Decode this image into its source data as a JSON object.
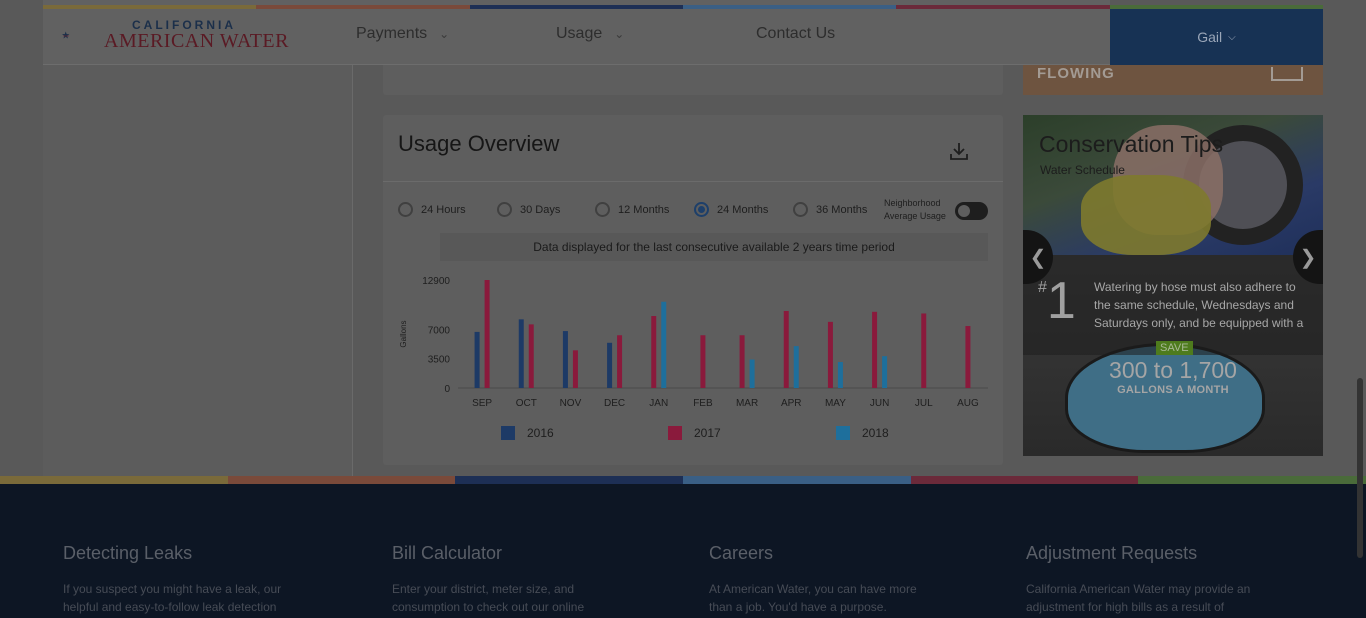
{
  "brand": {
    "name_top": "CALIFORNIA",
    "name_bottom": "AMERICAN WATER",
    "stripe_colors": [
      "#7a6a3a",
      "#7a4a3a",
      "#1d2f55",
      "#3a5f85",
      "#6b2a3a",
      "#4a6b3a"
    ]
  },
  "nav": {
    "payments": "Payments",
    "usage": "Usage",
    "contact": "Contact Us",
    "user": "Gail"
  },
  "promo_top": {
    "label": "FLOWING"
  },
  "usage": {
    "title": "Usage Overview",
    "periods": [
      {
        "label": "24 Hours",
        "checked": false
      },
      {
        "label": "30 Days",
        "checked": false
      },
      {
        "label": "12 Months",
        "checked": false
      },
      {
        "label": "24 Months",
        "checked": true
      },
      {
        "label": "36 Months",
        "checked": false
      }
    ],
    "neighborhood_line1": "Neighborhood",
    "neighborhood_line2": "Average Usage",
    "neighborhood_on": false,
    "notice": "Data displayed for the last consecutive available 2 years time period"
  },
  "chart_data": {
    "type": "bar",
    "ylabel": "Gallons",
    "ylim": [
      0,
      12900
    ],
    "yticks": [
      "12900",
      "7000",
      "3500",
      "0"
    ],
    "ytick_values": [
      12900,
      7000,
      3500,
      0
    ],
    "categories": [
      "SEP",
      "OCT",
      "NOV",
      "DEC",
      "JAN",
      "FEB",
      "MAR",
      "APR",
      "MAY",
      "JUN",
      "JUL",
      "AUG"
    ],
    "series": [
      {
        "name": "2016",
        "color": "#1d3a66",
        "values": [
          6700,
          8200,
          6800,
          5400,
          null,
          null,
          null,
          null,
          null,
          null,
          null,
          null
        ]
      },
      {
        "name": "2017",
        "color": "#8a1a3c",
        "values": [
          12900,
          7600,
          4500,
          6300,
          8600,
          6300,
          6300,
          9200,
          7900,
          9100,
          8900,
          7400
        ]
      },
      {
        "name": "2018",
        "color": "#1e6f9c",
        "values": [
          null,
          null,
          null,
          null,
          10300,
          null,
          3400,
          5000,
          3100,
          3800,
          null,
          null
        ]
      }
    ]
  },
  "conservation": {
    "title": "Conservation Tips",
    "subtitle": "Water Schedule",
    "tip_hash": "#",
    "tip_number": "1",
    "tip_text": "Watering by hose must also adhere to the same schedule, Wednesdays and Saturdays only, and be equipped with a",
    "save_label": "SAVE",
    "savings": "300 to 1,700",
    "savings_unit": "GALLONS A MONTH"
  },
  "footer": {
    "columns": [
      {
        "title": "Detecting Leaks",
        "text": "If you suspect you might have a leak, our helpful and easy-to-follow leak detection"
      },
      {
        "title": "Bill Calculator",
        "text": "Enter your district, meter size, and consumption to check out our online"
      },
      {
        "title": "Careers",
        "text": "At American Water, you can have more than a job. You'd have a purpose."
      },
      {
        "title": "Adjustment Requests",
        "text": "California American Water may provide an adjustment for high bills as a result of"
      }
    ]
  }
}
